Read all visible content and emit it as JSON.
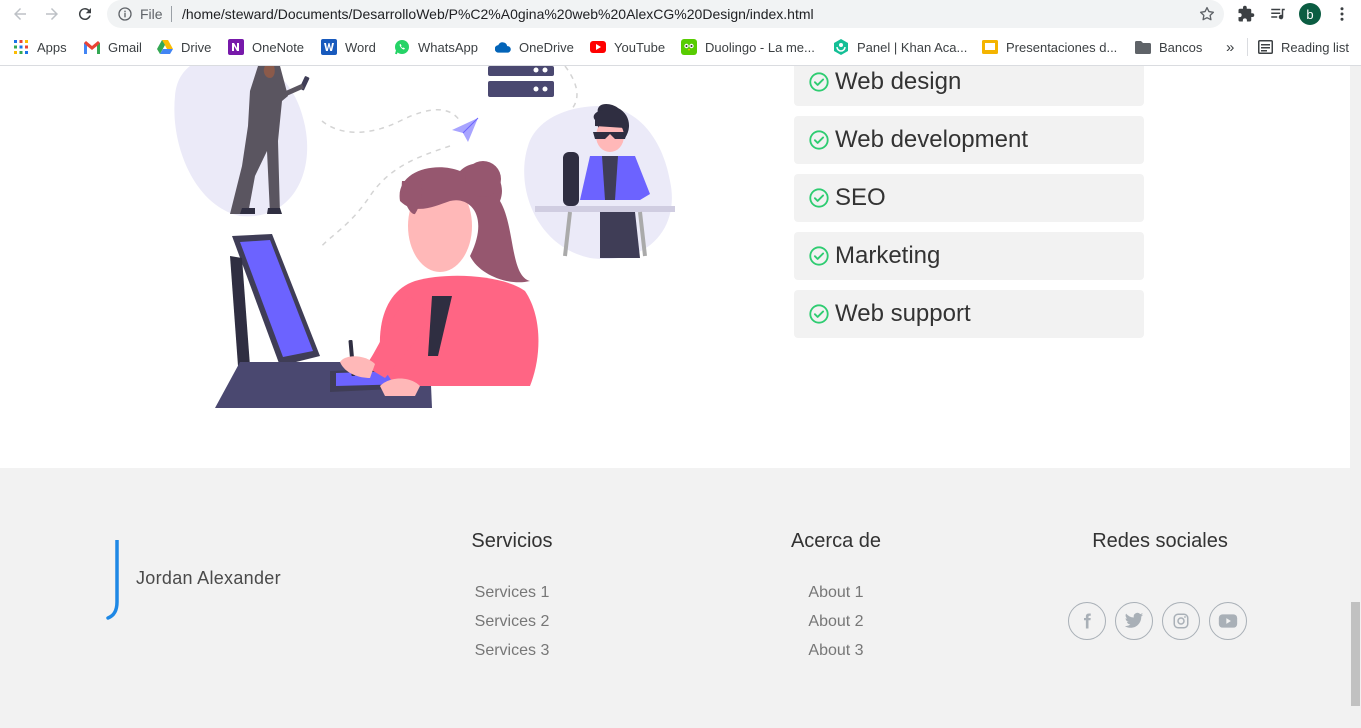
{
  "browser": {
    "url_scheme_label": "File",
    "url": "/home/steward/Documents/DesarrolloWeb/P%C2%A0gina%20web%20AlexCG%20Design/index.html",
    "profile_initial": "b",
    "bookmarks": [
      {
        "label": "Apps",
        "icon": "apps-grid-icon"
      },
      {
        "label": "Gmail",
        "icon": "gmail-icon"
      },
      {
        "label": "Drive",
        "icon": "drive-icon"
      },
      {
        "label": "OneNote",
        "icon": "onenote-icon"
      },
      {
        "label": "Word",
        "icon": "word-icon"
      },
      {
        "label": "WhatsApp",
        "icon": "whatsapp-icon"
      },
      {
        "label": "OneDrive",
        "icon": "onedrive-icon"
      },
      {
        "label": "YouTube",
        "icon": "youtube-icon"
      },
      {
        "label": "Duolingo - La me...",
        "icon": "duolingo-icon"
      },
      {
        "label": "Panel | Khan Aca...",
        "icon": "khan-academy-icon"
      },
      {
        "label": "Presentaciones d...",
        "icon": "slides-icon"
      },
      {
        "label": "Bancos",
        "icon": "folder-icon"
      }
    ],
    "more_bookmarks": "»",
    "reading_list": "Reading list"
  },
  "services": {
    "items": [
      "Web design",
      "Web development",
      "SEO",
      "Marketing",
      "Web support"
    ],
    "check_color": "#2ecc71"
  },
  "footer": {
    "logo_text": "Jordan Alexander",
    "logo_color": "#1e88e5",
    "columns": [
      {
        "title": "Servicios",
        "links": [
          "Services 1",
          "Services 2",
          "Services 3"
        ]
      },
      {
        "title": "Acerca de",
        "links": [
          "About 1",
          "About 2",
          "About 3"
        ]
      }
    ],
    "social_title": "Redes sociales",
    "social_icons": [
      "facebook-icon",
      "twitter-icon",
      "instagram-icon",
      "youtube-icon"
    ]
  },
  "colors": {
    "illustration_accent": "#6c63ff",
    "illustration_shirt": "#ff6584",
    "footer_bg": "#f2f2f2"
  }
}
